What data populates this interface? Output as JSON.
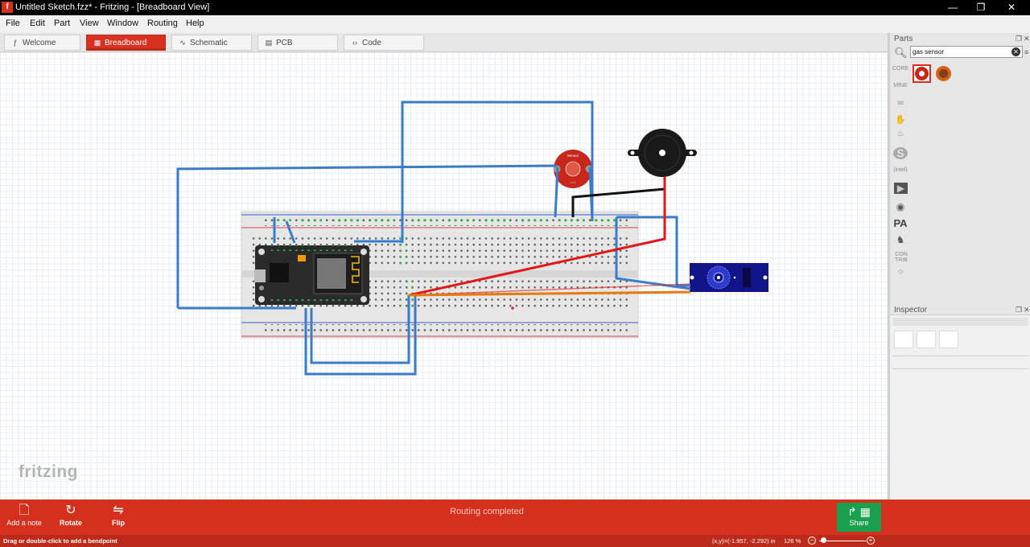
{
  "window": {
    "title": "Untitled Sketch.fzz* - Fritzing - [Breadboard View]",
    "app_icon": "fritzing-f-icon",
    "controls": [
      "minimize-icon",
      "restore-icon",
      "close-icon"
    ]
  },
  "menu": {
    "items": [
      "File",
      "Edit",
      "Part",
      "View",
      "Window",
      "Routing",
      "Help"
    ]
  },
  "tabs": [
    {
      "label": "Welcome",
      "icon": "fritzing-f-icon",
      "active": false
    },
    {
      "label": "Breadboard",
      "icon": "breadboard-icon",
      "active": true
    },
    {
      "label": "Schematic",
      "icon": "resistor-icon",
      "active": false
    },
    {
      "label": "PCB",
      "icon": "pcb-icon",
      "active": false
    },
    {
      "label": "Code",
      "icon": "code-brackets-icon",
      "active": false
    }
  ],
  "canvas": {
    "logo": "fritzing",
    "colors": {
      "wire_blue": "#3b7cc9",
      "wire_red": "#e01818",
      "wire_black": "#111111",
      "wire_orange": "#e8790c",
      "breadboard": "#e6e6e6",
      "sensor": "#c8281c",
      "servo": "#12148a"
    }
  },
  "parts_panel": {
    "title": "Parts",
    "search_value": "gas sensor",
    "bins": [
      "CORE",
      "MINE",
      "arduino-icon",
      "hand-icon",
      "seeed-icon",
      "sparkfun-icon",
      "intel-icon",
      "play-icon",
      "dot-icon",
      "PA",
      "animal-icon",
      "CON TRIB",
      "picaxe-icon"
    ],
    "results": [
      "gas-sensor-red-icon",
      "gas-sensor-orange-icon"
    ]
  },
  "inspector": {
    "title": "Inspector"
  },
  "toolbar": {
    "add_note": "Add a note",
    "rotate": "Rotate",
    "flip": "Flip",
    "routing_status": "Routing completed",
    "share": "Share"
  },
  "statusbar": {
    "message": "Drag or double-click to add a bendpoint",
    "coords": "(x,y)=(-1.957, -2.292) in",
    "zoom": "126 %"
  }
}
